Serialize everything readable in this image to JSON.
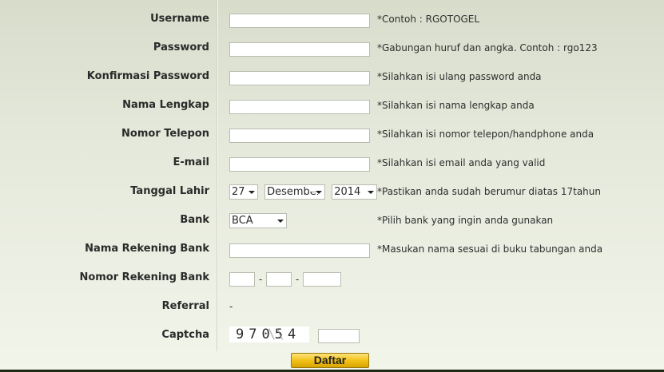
{
  "form": {
    "username": {
      "label": "Username",
      "value": "",
      "hint": "*Contoh : RGOTOGEL"
    },
    "password": {
      "label": "Password",
      "value": "",
      "hint": "*Gabungan huruf dan angka. Contoh : rgo123"
    },
    "confirm_password": {
      "label": "Konfirmasi Password",
      "value": "",
      "hint": "*Silahkan isi ulang password anda"
    },
    "full_name": {
      "label": "Nama Lengkap",
      "value": "",
      "hint": "*Silahkan isi nama lengkap anda"
    },
    "phone": {
      "label": "Nomor Telepon",
      "value": "",
      "hint": "*Silahkan isi nomor telepon/handphone anda"
    },
    "email": {
      "label": "E-mail",
      "value": "",
      "hint": "*Silahkan isi email anda yang valid"
    },
    "birth_date": {
      "label": "Tanggal Lahir",
      "day": "27",
      "month": "Desember",
      "year": "2014",
      "hint": "*Pastikan anda sudah berumur diatas 17tahun"
    },
    "bank": {
      "label": "Bank",
      "selected": "BCA",
      "hint": "*Pilih bank yang ingin anda gunakan"
    },
    "account_name": {
      "label": "Nama Rekening Bank",
      "value": "",
      "hint": "*Masukan nama sesuai di buku tabungan anda"
    },
    "account_number": {
      "label": "Nomor Rekening Bank",
      "part1": "",
      "part2": "",
      "part3": "",
      "separator": "-"
    },
    "referral": {
      "label": "Referral",
      "value": "-"
    },
    "captcha": {
      "label": "Captcha",
      "code": "97054",
      "value": ""
    },
    "submit_label": "Daftar"
  }
}
